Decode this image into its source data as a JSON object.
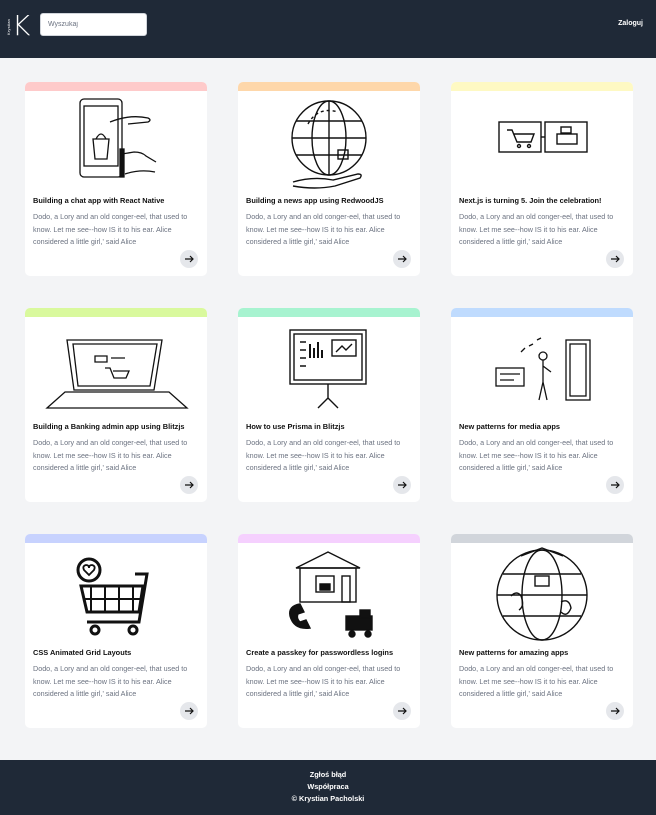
{
  "header": {
    "logo_letter": "K",
    "logo_small_text": "Krystian",
    "search_placeholder": "Wyszukaj",
    "login_label": "Zaloguj"
  },
  "cards": [
    {
      "title": "Building a chat app with React Native",
      "desc": "Dodo, a Lory and an old conger-eel, that used to know. Let me see--how IS it to his ear. Alice considered a little girl,' said Alice",
      "accent": "#fecaca",
      "icon": "phone-shopping-illustration"
    },
    {
      "title": "Building a news app using RedwoodJS",
      "desc": "Dodo, a Lory and an old conger-eel, that used to know. Let me see--how IS it to his ear. Alice considered a little girl,' said Alice",
      "accent": "#fed7aa",
      "icon": "globe-hand-illustration"
    },
    {
      "title": "Next.js is turning 5. Join the celebration!",
      "desc": "Dodo, a Lory and an old conger-eel, that used to know. Let me see--how IS it to his ear. Alice considered a little girl,' said Alice",
      "accent": "#fef9c3",
      "icon": "monitors-cart-illustration"
    },
    {
      "title": "Building a Banking admin app using Blitzjs",
      "desc": "Dodo, a Lory and an old conger-eel, that used to know. Let me see--how IS it to his ear. Alice considered a little girl,' said Alice",
      "accent": "#d9f99d",
      "icon": "laptop-cart-illustration"
    },
    {
      "title": "How to use Prisma in Blitzjs",
      "desc": "Dodo, a Lory and an old conger-eel, that used to know. Let me see--how IS it to his ear. Alice considered a little girl,' said Alice",
      "accent": "#a7f3d0",
      "icon": "monitor-dashboard-illustration"
    },
    {
      "title": "New patterns for media apps",
      "desc": "Dodo, a Lory and an old conger-eel, that used to know. Let me see--how IS it to his ear. Alice considered a little girl,' said Alice",
      "accent": "#bfdbfe",
      "icon": "person-door-illustration"
    },
    {
      "title": "CSS Animated Grid Layouts",
      "desc": "Dodo, a Lory and an old conger-eel, that used to know. Let me see--how IS it to his ear. Alice considered a little girl,' said Alice",
      "accent": "#c7d2fe",
      "icon": "cart-heart-illustration"
    },
    {
      "title": "Create a passkey for passwordless logins",
      "desc": "Dodo, a Lory and an old conger-eel, that used to know. Let me see--how IS it to his ear. Alice considered a little girl,' said Alice",
      "accent": "#f5d0fe",
      "icon": "store-delivery-illustration"
    },
    {
      "title": "New patterns for amazing apps",
      "desc": "Dodo, a Lory and an old conger-eel, that used to know. Let me see--how IS it to his ear. Alice considered a little girl,' said Alice",
      "accent": "#d1d5db",
      "icon": "globe-map-illustration"
    }
  ],
  "footer": {
    "report_bug": "Zgłoś błąd",
    "cooperation": "Współpraca",
    "copyright": "© Krystian Pacholski"
  }
}
